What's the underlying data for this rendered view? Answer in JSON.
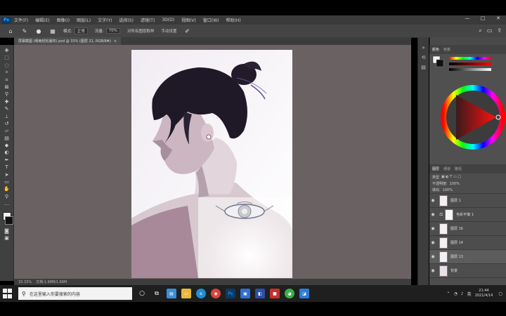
{
  "app": {
    "logo_text": "Ps"
  },
  "menu": {
    "items": [
      "文件(F)",
      "编辑(E)",
      "图像(I)",
      "图层(L)",
      "文字(Y)",
      "选择(S)",
      "滤镜(T)",
      "3D(D)",
      "视图(V)",
      "窗口(W)",
      "帮助(H)"
    ],
    "window_controls": [
      "—",
      "□",
      "✕"
    ]
  },
  "options": {
    "mode_label": "模式:",
    "mode_value": "正常",
    "opacity_label": "流量:",
    "opacity_value": "70%",
    "option1": "对所有图层取样",
    "option2": "手动设置"
  },
  "document": {
    "tab_title": "屏幕截图 (晴雨轻松版权).psd @ 33% (图层 21, RGB/8#)",
    "close": "×"
  },
  "status": {
    "zoom": "33.33%",
    "doc_info": "文档:1.98M/1.66M"
  },
  "layers": {
    "tabs": [
      "图层",
      "通道",
      "路径"
    ],
    "kind_label": "类型",
    "opacity_label": "不透明度:",
    "opacity_value": "100%",
    "fill_label": "填充:",
    "fill_value": "100%",
    "items": [
      {
        "name": "图层 1"
      },
      {
        "name": "色彩平衡 1"
      },
      {
        "name": "图层 16"
      },
      {
        "name": "图层 14"
      },
      {
        "name": "图层 13"
      },
      {
        "name": "背景"
      }
    ]
  },
  "color_panel": {
    "tabs": [
      "颜色",
      "色板"
    ]
  },
  "taskbar": {
    "search_placeholder": "在这里输入你要搜索的内容",
    "time": "21:44",
    "date": "2021/4/14",
    "lang": "英"
  },
  "icons": {
    "home": "home-icon",
    "brush": "brush-icon",
    "search": "search-icon",
    "windows": "windows-icon"
  },
  "colors": {
    "accent": "#31a8ff",
    "canvas_bg": "#6a6262",
    "panel": "#4a4a4a"
  }
}
